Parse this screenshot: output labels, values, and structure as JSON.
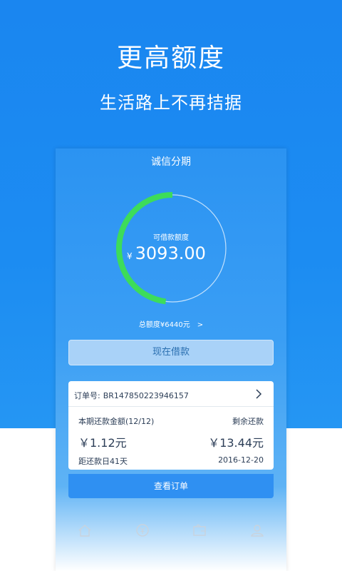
{
  "hero": {
    "title": "更高额度",
    "subtitle": "生活路上不再拮据"
  },
  "app": {
    "title": "诚信分期",
    "credit": {
      "label": "可借款额度",
      "currency": "¥",
      "amount": "3093.00",
      "fill_fraction": 0.48,
      "total_text": "总额度¥6440元",
      "total_arrow": ">"
    },
    "borrow_button": "现在借款",
    "order": {
      "number_label": "订单号:",
      "number": "BR147850223946157",
      "period_label": "本期还款金额(12/12)",
      "remaining_label": "剩余还款",
      "period_amount": "￥1.12元",
      "remaining_amount": "￥13.44元",
      "due_text": "距还款日41天",
      "due_date": "2016-12-20"
    },
    "view_order_button": "查看订单",
    "tabs": [
      {
        "icon": "home-icon",
        "active": true
      },
      {
        "icon": "yen-coin-icon",
        "active": false
      },
      {
        "icon": "wallet-icon",
        "active": false
      },
      {
        "icon": "user-icon",
        "active": false
      }
    ]
  },
  "colors": {
    "hero_blue": "#1a86f0",
    "gauge_green": "#3ddc5a",
    "text_dark": "#2c3e57",
    "tab_icon": "#c9d3dd"
  }
}
